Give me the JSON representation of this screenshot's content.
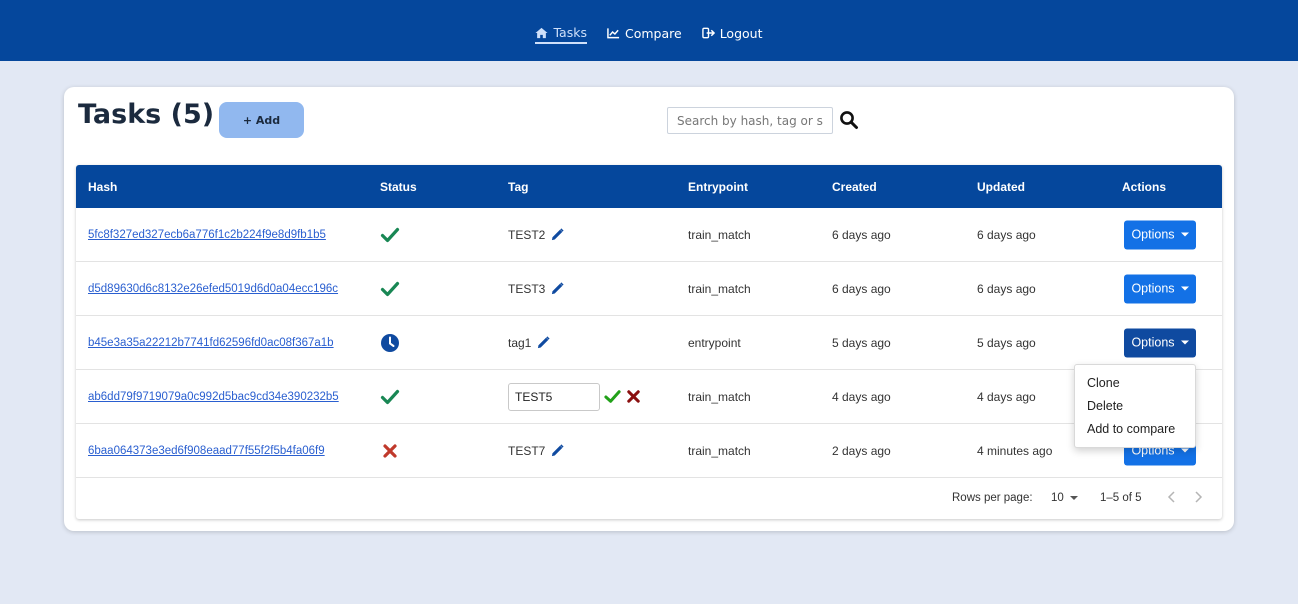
{
  "nav": {
    "tasks_label": "Tasks",
    "compare_label": "Compare",
    "logout_label": "Logout"
  },
  "header": {
    "title": "Tasks (5)",
    "add_label": "+ Add",
    "search_placeholder": "Search by hash, tag or status"
  },
  "table": {
    "columns": [
      "Hash",
      "Status",
      "Tag",
      "Entrypoint",
      "Created",
      "Updated",
      "Actions"
    ],
    "rows": [
      {
        "hash": "5fc8f327ed327ecb6a776f1c2b224f9e8d9fb1b5",
        "status": "success",
        "tag": "TEST2",
        "entrypoint": "train_match",
        "created": "6 days ago",
        "updated": "6 days ago",
        "action": "Options"
      },
      {
        "hash": "d5d89630d6c8132e26efed5019d6d0a04ecc196c",
        "status": "success",
        "tag": "TEST3",
        "entrypoint": "train_match",
        "created": "6 days ago",
        "updated": "6 days ago",
        "action": "Options"
      },
      {
        "hash": "b45e3a35a22212b7741fd62596fd0ac08f367a1b",
        "status": "pending",
        "tag": "tag1",
        "entrypoint": "entrypoint",
        "created": "5 days ago",
        "updated": "5 days ago",
        "action": "Options"
      },
      {
        "hash": "ab6dd79f9719079a0c992d5bac9cd34e390232b5",
        "status": "success",
        "tag": "TEST5",
        "entrypoint": "train_match",
        "created": "4 days ago",
        "updated": "4 days ago",
        "action": "Options"
      },
      {
        "hash": "6baa064373e3ed6f908eaad77f55f2f5b4fa06f9",
        "status": "failed",
        "tag": "TEST7",
        "entrypoint": "train_match",
        "created": "2 days ago",
        "updated": "4 minutes ago",
        "action": "Options"
      }
    ]
  },
  "pagination": {
    "rows_per_page_label": "Rows per page:",
    "rows_per_page_value": "10",
    "range": "1–5 of 5"
  },
  "menu": {
    "items": [
      "Clone",
      "Delete",
      "Add to compare"
    ]
  },
  "colors": {
    "navbar": "#05479c",
    "success": "#198754",
    "failed": "#c0392b",
    "pending": "#0f4aa0",
    "primary_button": "#1371e6"
  }
}
